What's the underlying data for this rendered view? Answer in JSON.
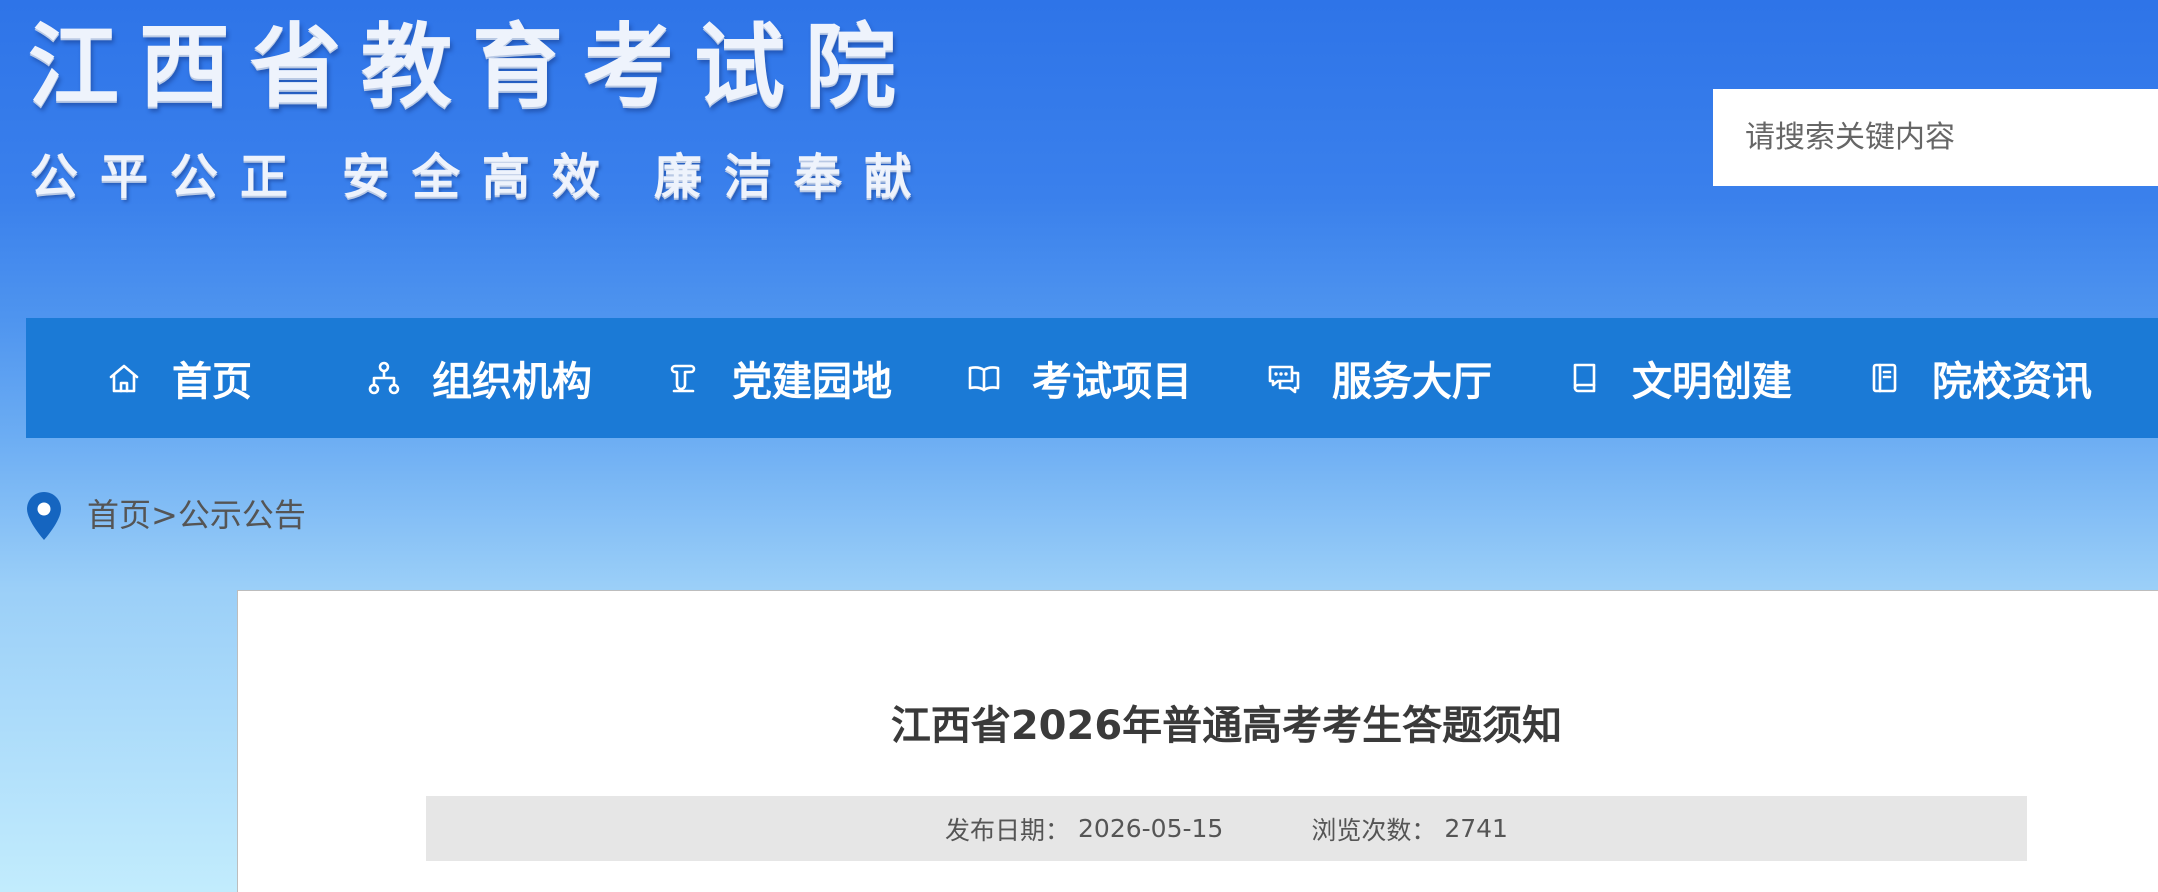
{
  "site": {
    "title": "江西省教育考试院",
    "slogan": [
      "公平公正",
      "安全高效",
      "廉洁奉献"
    ]
  },
  "search": {
    "placeholder": "请搜索关键内容"
  },
  "nav": {
    "items": [
      {
        "label": "首页",
        "icon": "home-icon"
      },
      {
        "label": "组织机构",
        "icon": "org-chart-icon"
      },
      {
        "label": "党建园地",
        "icon": "party-building-icon"
      },
      {
        "label": "考试项目",
        "icon": "open-book-icon"
      },
      {
        "label": "服务大厅",
        "icon": "chat-service-icon"
      },
      {
        "label": "文明创建",
        "icon": "book-icon"
      },
      {
        "label": "院校资讯",
        "icon": "notebook-icon"
      }
    ]
  },
  "breadcrumb": {
    "icon": "location-pin-icon",
    "home": "首页",
    "separator": ">",
    "current": "公示公告"
  },
  "article": {
    "title": "江西省2026年普通高考考生答题须知",
    "date_label": "发布日期：",
    "date": "2026-05-15",
    "views_label": "浏览次数：",
    "views": "2741"
  },
  "colors": {
    "header_top": "#2e74e8",
    "page_bottom": "#c2ecfd",
    "nav_bar": "#1b7ad6",
    "pin": "#1565c0",
    "meta_bar": "#e6e6e6",
    "title_text": "#3a3a3a"
  }
}
